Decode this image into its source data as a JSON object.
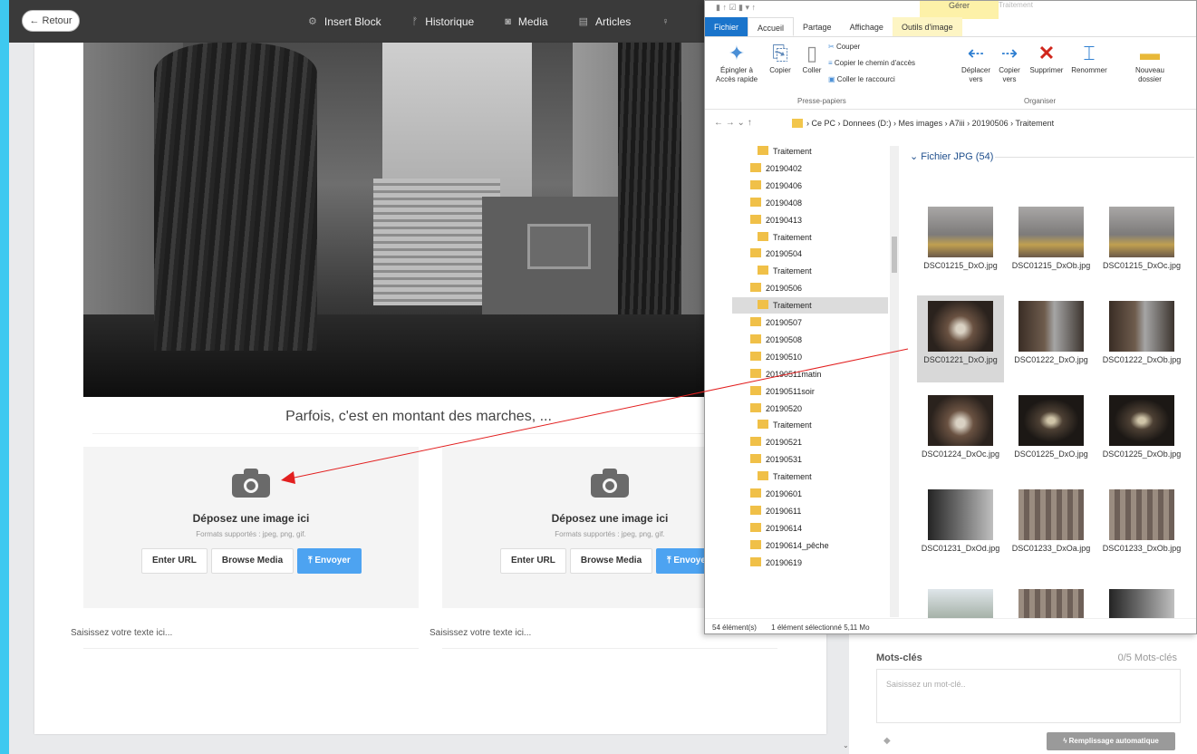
{
  "topbar": {
    "back_label": "← Retour",
    "items": [
      "Insert Block",
      "Historique",
      "Media",
      "Articles"
    ]
  },
  "editor": {
    "caption": "Parfois, c'est en montant des marches, ...",
    "drop_title": "Déposez une image ici",
    "drop_formats": "Formats supportés : jpeg, png, gif.",
    "btn_url": "Enter URL",
    "btn_browse": "Browse Media",
    "btn_send": "Envoyer",
    "text_placeholder": "Saisissez votre texte ici..."
  },
  "sidebar": {
    "keywords_label": "Mots-clés",
    "keywords_count": "0/5 Mots-clés",
    "keyword_placeholder": "Saisissez un mot-clé..",
    "auto_fill": "Remplissage automatique"
  },
  "explorer": {
    "context_tab": "Gérer",
    "context_tab2": "Traitement",
    "tabs": [
      "Fichier",
      "Accueil",
      "Partage",
      "Affichage",
      "Outils d'image"
    ],
    "ribbon": {
      "pin": "Épingler à Accès rapide",
      "copy": "Copier",
      "paste": "Coller",
      "cut": "Couper",
      "copy_path": "Copier le chemin d'accès",
      "paste_shortcut": "Coller le raccourci",
      "clipboard_group": "Presse-papiers",
      "move": "Déplacer vers",
      "copy_to": "Copier vers",
      "delete": "Supprimer",
      "rename": "Renommer",
      "organize_group": "Organiser",
      "new_folder": "Nouveau dossier"
    },
    "breadcrumb": [
      "Ce PC",
      "Donnees (D:)",
      "Mes images",
      "A7iii",
      "20190506",
      "Traitement"
    ],
    "tree": [
      {
        "label": "Traitement",
        "indent": true
      },
      {
        "label": "20190402",
        "indent": false
      },
      {
        "label": "20190406",
        "indent": false
      },
      {
        "label": "20190408",
        "indent": false
      },
      {
        "label": "20190413",
        "indent": false
      },
      {
        "label": "Traitement",
        "indent": true
      },
      {
        "label": "20190504",
        "indent": false
      },
      {
        "label": "Traitement",
        "indent": true
      },
      {
        "label": "20190506",
        "indent": false
      },
      {
        "label": "Traitement",
        "indent": true,
        "selected": true
      },
      {
        "label": "20190507",
        "indent": false
      },
      {
        "label": "20190508",
        "indent": false
      },
      {
        "label": "20190510",
        "indent": false
      },
      {
        "label": "20190511matin",
        "indent": false
      },
      {
        "label": "20190511soir",
        "indent": false
      },
      {
        "label": "20190520",
        "indent": false
      },
      {
        "label": "Traitement",
        "indent": true
      },
      {
        "label": "20190521",
        "indent": false
      },
      {
        "label": "20190531",
        "indent": false
      },
      {
        "label": "Traitement",
        "indent": true
      },
      {
        "label": "20190601",
        "indent": false
      },
      {
        "label": "20190611",
        "indent": false
      },
      {
        "label": "20190614",
        "indent": false
      },
      {
        "label": "20190614_pêche",
        "indent": false
      },
      {
        "label": "20190619",
        "indent": false
      }
    ],
    "group_header": "Fichier JPG (54)",
    "files": [
      {
        "name": "DSC01215_DxO.jpg",
        "kind": "street"
      },
      {
        "name": "DSC01215_DxOb.jpg",
        "kind": "street"
      },
      {
        "name": "DSC01215_DxOc.jpg",
        "kind": "street"
      },
      {
        "name": "DSC01221_DxO.jpg",
        "kind": "alley",
        "selected": true
      },
      {
        "name": "DSC01222_DxO.jpg",
        "kind": "lantern"
      },
      {
        "name": "DSC01222_DxOb.jpg",
        "kind": "lantern"
      },
      {
        "name": "DSC01224_DxOc.jpg",
        "kind": "alley"
      },
      {
        "name": "DSC01225_DxO.jpg",
        "kind": "dark"
      },
      {
        "name": "DSC01225_DxOb.jpg",
        "kind": "dark"
      },
      {
        "name": "DSC01231_DxOd.jpg",
        "kind": "arc"
      },
      {
        "name": "DSC01233_DxOa.jpg",
        "kind": "colon"
      },
      {
        "name": "DSC01233_DxOb.jpg",
        "kind": "colon"
      }
    ],
    "status_count": "54 élément(s)",
    "status_selected": "1 élément sélectionné 5,11 Mo"
  }
}
